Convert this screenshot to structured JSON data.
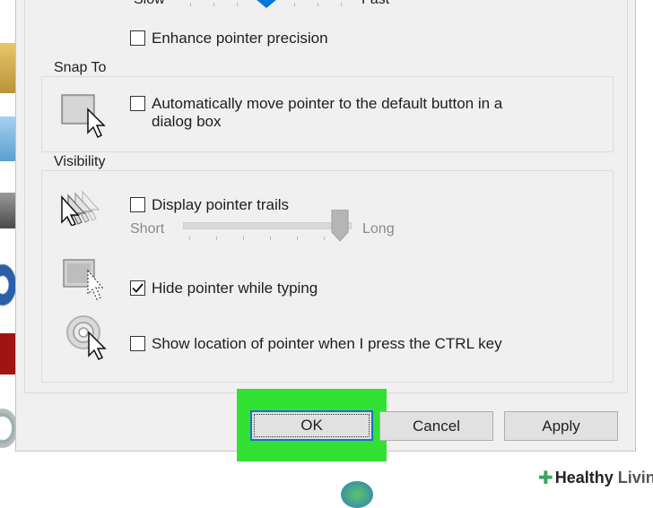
{
  "speed_slider": {
    "min_label": "Slow",
    "max_label": "Fast"
  },
  "enhance_precision": {
    "label": "Enhance pointer precision",
    "checked": false
  },
  "snap_to": {
    "title": "Snap To",
    "checkbox": {
      "label_line1": "Automatically move pointer to the default button in a",
      "label_line2": "dialog box",
      "checked": false
    }
  },
  "visibility": {
    "title": "Visibility",
    "trails": {
      "label": "Display pointer trails",
      "checked": false
    },
    "trail_slider": {
      "min_label": "Short",
      "max_label": "Long",
      "level": 1.0
    },
    "hide_typing": {
      "label": "Hide pointer while typing",
      "checked": true
    },
    "ctrl_location": {
      "label": "Show location of pointer when I press the CTRL key",
      "checked": false
    }
  },
  "buttons": {
    "ok": "OK",
    "cancel": "Cancel",
    "apply": "Apply"
  },
  "watermark": {
    "brand_first": "Healthy",
    "brand_second": "Living"
  },
  "colors": {
    "highlight": "#33e133",
    "ok_focus_border": "#1a6fd0",
    "slider_thumb": "#0078d7"
  }
}
